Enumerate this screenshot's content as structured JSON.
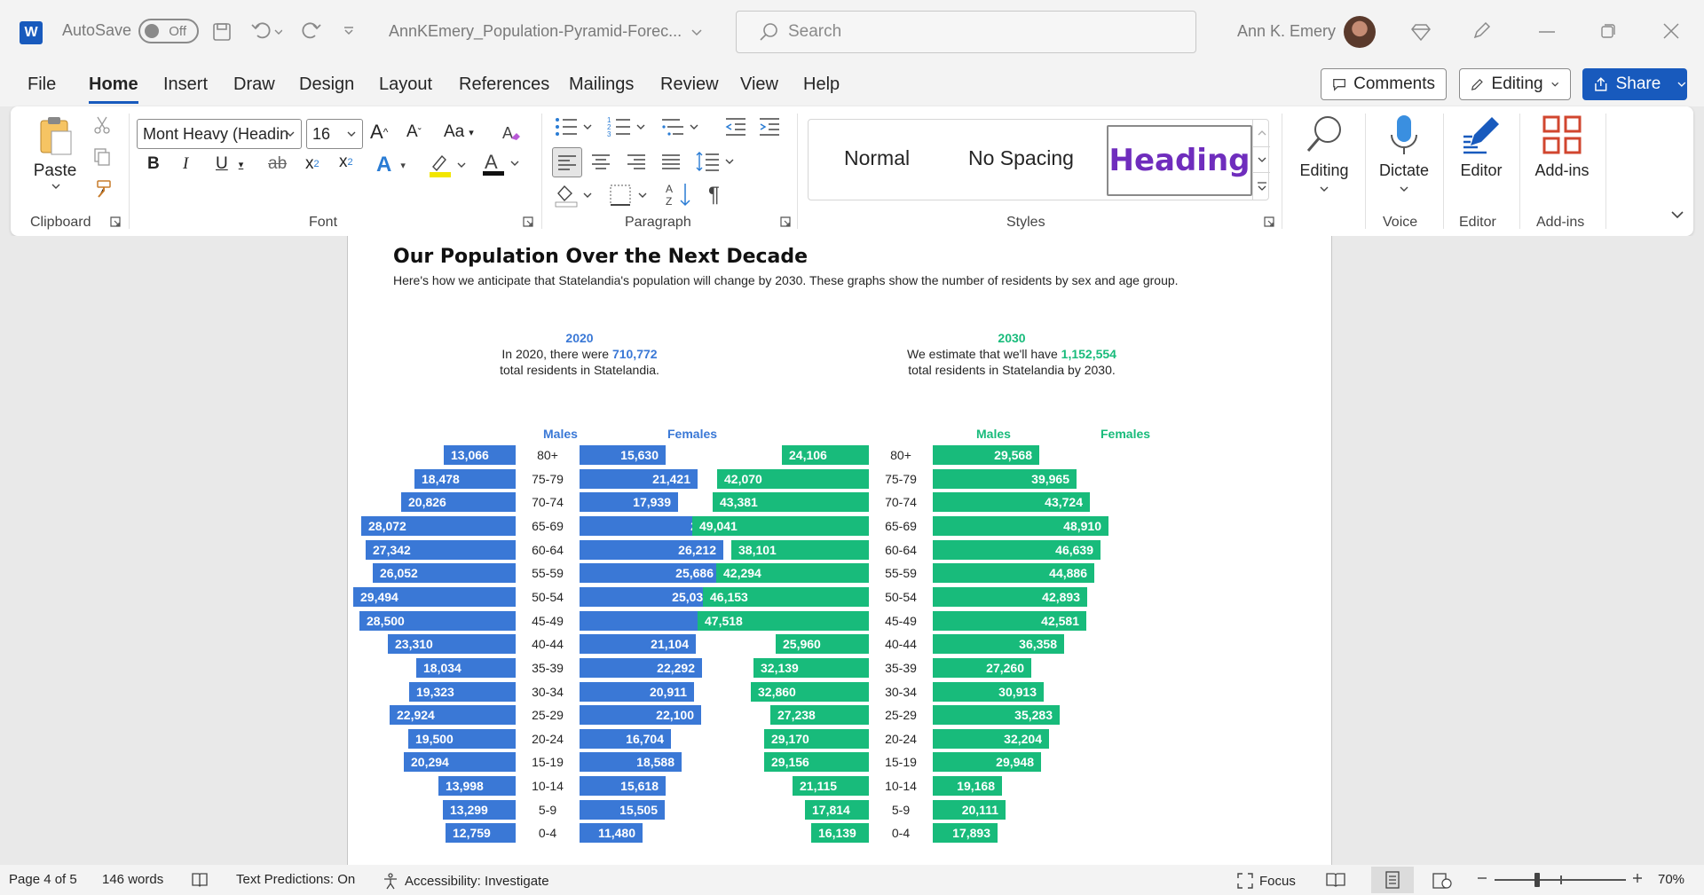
{
  "titlebar": {
    "autosave_label": "AutoSave",
    "autosave_state": "Off",
    "doc_name": "AnnKEmery_Population-Pyramid-Forec...",
    "search_placeholder": "Search",
    "user_name": "Ann K. Emery"
  },
  "menu": [
    "File",
    "Home",
    "Insert",
    "Draw",
    "Design",
    "Layout",
    "References",
    "Mailings",
    "Review",
    "View",
    "Help"
  ],
  "top_right": {
    "comments": "Comments",
    "editing": "Editing",
    "share": "Share"
  },
  "ribbon": {
    "paste": "Paste",
    "font_name": "Mont Heavy (Headin",
    "font_size": "16",
    "styles": {
      "normal": "Normal",
      "no_spacing": "No Spacing",
      "heading": "Heading"
    },
    "editing": "Editing",
    "dictate": "Dictate",
    "editor": "Editor",
    "addins": "Add-ins",
    "groups": {
      "clipboard": "Clipboard",
      "font": "Font",
      "paragraph": "Paragraph",
      "styles": "Styles",
      "voice": "Voice",
      "editor": "Editor",
      "addins": "Add-ins"
    }
  },
  "document": {
    "title": "Our Population Over the Next Decade",
    "subtitle": "Here's how we anticipate that Statelandia's population will change by 2030. These graphs show the number of residents by sex and age group.",
    "left": {
      "year": "2020",
      "line1_pre": "In 2020, there were ",
      "total": "710,772",
      "line2": "total residents in Statelandia.",
      "males_label": "Males",
      "females_label": "Females",
      "color": "#3a78d6"
    },
    "right": {
      "year": "2030",
      "line1_pre": "We estimate that we'll have ",
      "total": "1,152,554",
      "line2": "total residents in Statelandia by 2030.",
      "males_label": "Males",
      "females_label": "Females",
      "color": "#18bb7b"
    }
  },
  "chart_data": [
    {
      "type": "bar",
      "title": "2020",
      "categories": [
        "80+",
        "75-79",
        "70-74",
        "65-69",
        "60-64",
        "55-59",
        "50-54",
        "45-49",
        "40-44",
        "35-39",
        "30-34",
        "25-29",
        "20-24",
        "15-19",
        "10-14",
        "5-9",
        "0-4"
      ],
      "series": [
        {
          "name": "Males",
          "values": [
            13066,
            18478,
            20826,
            28072,
            27342,
            26052,
            29494,
            28500,
            23310,
            18034,
            19323,
            22924,
            19500,
            20294,
            13998,
            13299,
            12759
          ]
        },
        {
          "name": "Females",
          "values": [
            15630,
            21421,
            17939,
            28410,
            26212,
            25686,
            25034,
            30865,
            21104,
            22292,
            20911,
            22100,
            16704,
            18588,
            15618,
            15505,
            11480
          ]
        }
      ],
      "labels_m": [
        "13,066",
        "18,478",
        "20,826",
        "28,072",
        "27,342",
        "26,052",
        "29,494",
        "28,500",
        "23,310",
        "18,034",
        "19,323",
        "22,924",
        "19,500",
        "20,294",
        "13,998",
        "13,299",
        "12,759"
      ],
      "labels_f": [
        "15,630",
        "21,421",
        "17,939",
        "28,410",
        "26,212",
        "25,686",
        "25,034",
        "30,865",
        "21,104",
        "22,292",
        "20,911",
        "22,100",
        "16,704",
        "18,588",
        "15,618",
        "15,505",
        "11,480"
      ]
    },
    {
      "type": "bar",
      "title": "2030",
      "categories": [
        "80+",
        "75-79",
        "70-74",
        "65-69",
        "60-64",
        "55-59",
        "50-54",
        "45-49",
        "40-44",
        "35-39",
        "30-34",
        "25-29",
        "20-24",
        "15-19",
        "10-14",
        "5-9",
        "0-4"
      ],
      "series": [
        {
          "name": "Males",
          "values": [
            24106,
            42070,
            43381,
            49041,
            38101,
            42294,
            46153,
            47518,
            25960,
            32139,
            32860,
            27238,
            29170,
            29156,
            21115,
            17814,
            16139
          ]
        },
        {
          "name": "Females",
          "values": [
            29568,
            39965,
            43724,
            48910,
            46639,
            44886,
            42893,
            42581,
            36358,
            27260,
            30913,
            35283,
            32204,
            29948,
            19168,
            20111,
            17893
          ]
        }
      ],
      "labels_m": [
        "24,106",
        "42,070",
        "43,381",
        "49,041",
        "38,101",
        "42,294",
        "46,153",
        "47,518",
        "25,960",
        "32,139",
        "32,860",
        "27,238",
        "29,170",
        "29,156",
        "21,115",
        "17,814",
        "16,139"
      ],
      "labels_f": [
        "29,568",
        "39,965",
        "43,724",
        "48,910",
        "46,639",
        "44,886",
        "42,893",
        "42,581",
        "36,358",
        "27,260",
        "30,913",
        "35,283",
        "32,204",
        "29,948",
        "19,168",
        "20,111",
        "17,893"
      ]
    }
  ],
  "statusbar": {
    "page": "Page 4 of 5",
    "words": "146 words",
    "text_predictions": "Text Predictions: On",
    "accessibility": "Accessibility: Investigate",
    "focus": "Focus",
    "zoom": "70%"
  }
}
